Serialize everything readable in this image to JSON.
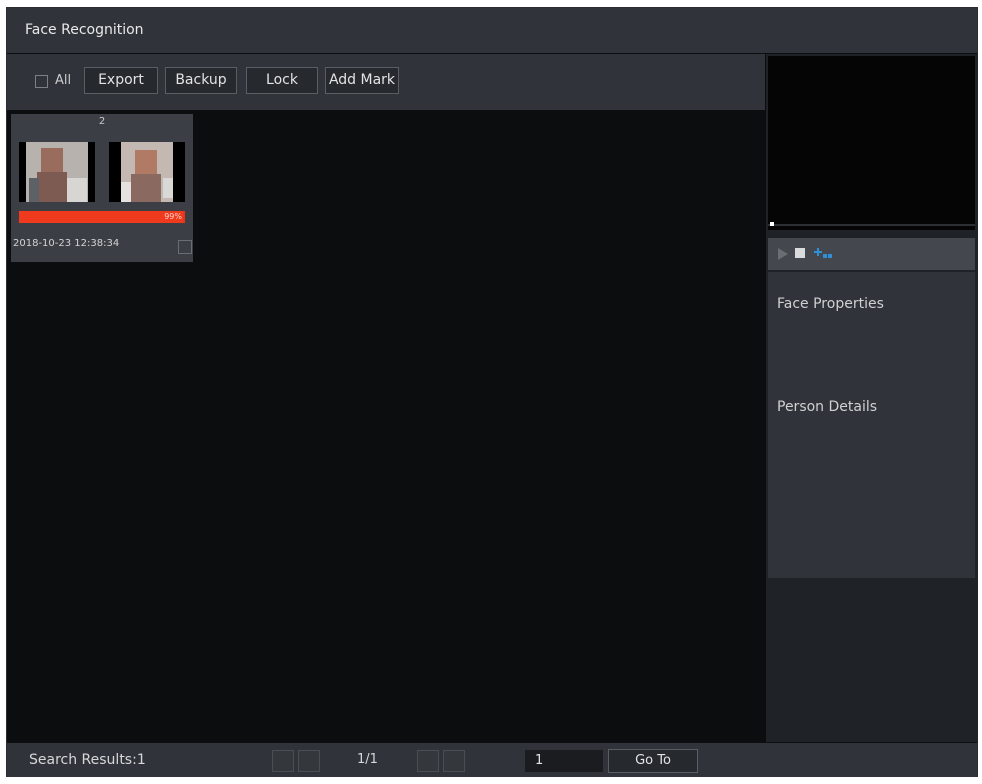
{
  "window": {
    "title": "Face Recognition"
  },
  "toolbar": {
    "all_label": "All",
    "buttons": [
      "Export",
      "Backup",
      "Lock",
      "Add Mark"
    ]
  },
  "results": [
    {
      "index": "2",
      "similarity": "99%",
      "similarity_value": 0.99,
      "timestamp": "2018-10-23 12:38:34"
    }
  ],
  "side_panel": {
    "face_properties_label": "Face Properties",
    "person_details_label": "Person Details"
  },
  "footer": {
    "search_results": "Search Results:1",
    "page_indicator": "1/1",
    "page_input_value": "1",
    "goto_label": "Go To"
  },
  "colors": {
    "accent": "#ef3a1d",
    "play_icon": "#2f8fd6"
  }
}
